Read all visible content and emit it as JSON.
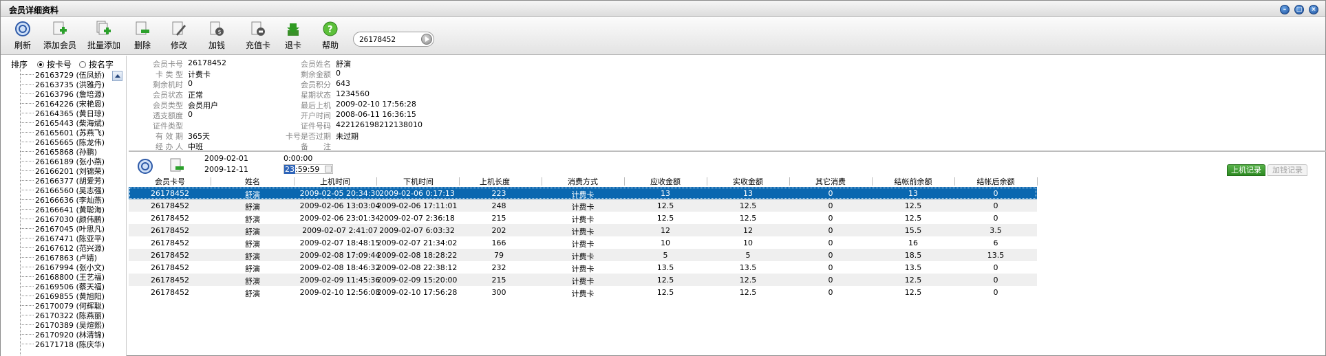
{
  "window": {
    "title": "会员详细资料"
  },
  "toolbar": {
    "items": [
      {
        "label": "刷新",
        "icon": "refresh-icon"
      },
      {
        "label": "添加会员",
        "icon": "add-member-icon"
      },
      {
        "label": "批量添加",
        "icon": "batch-add-icon"
      },
      {
        "label": "删除",
        "icon": "delete-icon"
      },
      {
        "label": "修改",
        "icon": "edit-icon"
      },
      {
        "label": "加钱",
        "icon": "add-money-icon"
      },
      {
        "label": "充值卡",
        "icon": "recharge-card-icon"
      },
      {
        "label": "退卡",
        "icon": "return-card-icon"
      },
      {
        "label": "帮助",
        "icon": "help-icon"
      }
    ],
    "search_value": "26178452"
  },
  "sidebar": {
    "sort_label": "排序",
    "sort_by_card": "按卡号",
    "sort_by_name": "按名字",
    "members": [
      "26163729 (伍凤娇)",
      "26163735 (洪雅丹)",
      "26163796 (詹培源)",
      "26164226 (宋艳恩)",
      "26164365 (黄日琼)",
      "26165443 (柴海斌)",
      "26165601 (苏燕飞)",
      "26165665 (陈龙伟)",
      "26165868 (孙鹏)",
      "26166189 (张小燕)",
      "26166201 (刘锦荣)",
      "26166377 (胡爱芳)",
      "26166560 (吴志强)",
      "26166636 (李灿燕)",
      "26166641 (黄聪海)",
      "26167030 (颜伟鹏)",
      "26167045 (叶思凡)",
      "26167471 (陈亚平)",
      "26167612 (范兴源)",
      "26167863 (卢婧)",
      "26167994 (张小文)",
      "26168800 (王艺福)",
      "26169506 (蔡天福)",
      "26169855 (黄旭阳)",
      "26170079 (何辉聪)",
      "26170322 (陈燕丽)",
      "26170389 (吴煊熙)",
      "26170920 (林清锦)",
      "26171718 (陈庆华)"
    ]
  },
  "info": {
    "left": [
      {
        "label": "会员卡号",
        "value": "26178452"
      },
      {
        "label": "卡 类 型",
        "value": "计费卡"
      },
      {
        "label": "剩余机时",
        "value": "0"
      },
      {
        "label": "会员状态",
        "value": "正常"
      },
      {
        "label": "会员类型",
        "value": "会员用户"
      },
      {
        "label": "透支额度",
        "value": "0"
      },
      {
        "label": "证件类型",
        "value": ""
      },
      {
        "label": "有 效 期",
        "value": "365天"
      },
      {
        "label": "经 办 人",
        "value": "中班"
      }
    ],
    "right": [
      {
        "label": "会员姓名",
        "value": "舒演"
      },
      {
        "label": "剩余金额",
        "value": "0"
      },
      {
        "label": "会员积分",
        "value": "643"
      },
      {
        "label": "星期状态",
        "value": "1234560"
      },
      {
        "label": "最后上机",
        "value": "2009-02-10 17:56:28"
      },
      {
        "label": "开户时间",
        "value": "2008-06-11 16:36:15"
      },
      {
        "label": "证件号码",
        "value": "422126198212138010"
      },
      {
        "label": "卡号是否过期",
        "value": "未过期"
      },
      {
        "label": "备　　注",
        "value": ""
      }
    ]
  },
  "filter": {
    "date_from": "2009-02-01",
    "date_to": "2009-12-11",
    "time_from": "0:00:00",
    "time_to_hour": "23",
    "time_to_rest": ":59:59"
  },
  "tabs": {
    "login_records": "上机记录",
    "recharge_records": "加钱记录"
  },
  "table": {
    "headers": [
      "会员卡号",
      "姓名",
      "上机时间",
      "下机时间",
      "上机长度",
      "消费方式",
      "应收金额",
      "实收金额",
      "其它消费",
      "结帐前余额",
      "结帐后余额"
    ],
    "rows": [
      [
        "26178452",
        "舒演",
        "2009-02-05 20:34:30",
        "2009-02-06 0:17:13",
        "223",
        "计费卡",
        "13",
        "13",
        "0",
        "13",
        "0"
      ],
      [
        "26178452",
        "舒演",
        "2009-02-06 13:03:04",
        "2009-02-06 17:11:01",
        "248",
        "计费卡",
        "12.5",
        "12.5",
        "0",
        "12.5",
        "0"
      ],
      [
        "26178452",
        "舒演",
        "2009-02-06 23:01:34",
        "2009-02-07 2:36:18",
        "215",
        "计费卡",
        "12.5",
        "12.5",
        "0",
        "12.5",
        "0"
      ],
      [
        "26178452",
        "舒演",
        "2009-02-07 2:41:07",
        "2009-02-07 6:03:32",
        "202",
        "计费卡",
        "12",
        "12",
        "0",
        "15.5",
        "3.5"
      ],
      [
        "26178452",
        "舒演",
        "2009-02-07 18:48:15",
        "2009-02-07 21:34:02",
        "166",
        "计费卡",
        "10",
        "10",
        "0",
        "16",
        "6"
      ],
      [
        "26178452",
        "舒演",
        "2009-02-08 17:09:44",
        "2009-02-08 18:28:22",
        "79",
        "计费卡",
        "5",
        "5",
        "0",
        "18.5",
        "13.5"
      ],
      [
        "26178452",
        "舒演",
        "2009-02-08 18:46:32",
        "2009-02-08 22:38:12",
        "232",
        "计费卡",
        "13.5",
        "13.5",
        "0",
        "13.5",
        "0"
      ],
      [
        "26178452",
        "舒演",
        "2009-02-09 11:45:36",
        "2009-02-09 15:20:00",
        "215",
        "计费卡",
        "12.5",
        "12.5",
        "0",
        "12.5",
        "0"
      ],
      [
        "26178452",
        "舒演",
        "2009-02-10 12:56:08",
        "2009-02-10 17:56:28",
        "300",
        "计费卡",
        "12.5",
        "12.5",
        "0",
        "12.5",
        "0"
      ]
    ]
  }
}
